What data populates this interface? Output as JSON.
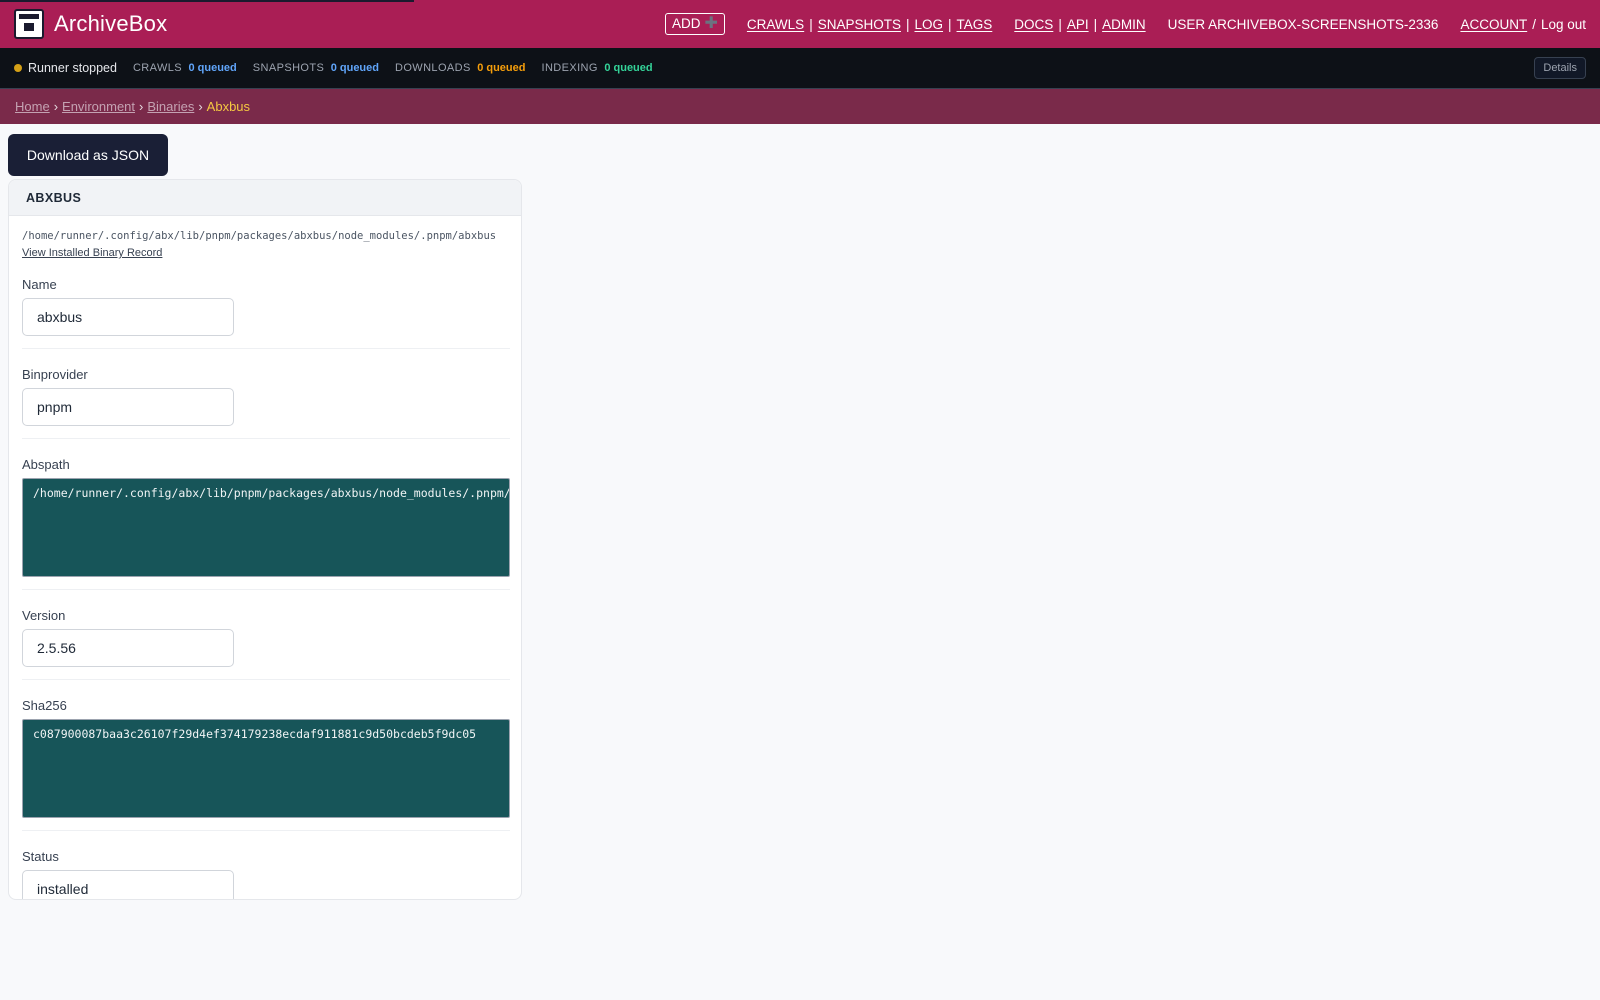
{
  "header": {
    "title": "ArchiveBox",
    "add_label": "ADD",
    "nav_main": [
      "CRAWLS",
      "SNAPSHOTS",
      "LOG",
      "TAGS"
    ],
    "nav_docs": [
      "DOCS",
      "API",
      "ADMIN"
    ],
    "user_label": "USER ARCHIVEBOX-SCREENSHOTS-2336",
    "account_label": "ACCOUNT",
    "account_sep": "/",
    "logout_label": "Log out"
  },
  "status": {
    "runner": "Runner stopped",
    "crawls_label": "CRAWLS",
    "crawls_value": "0 queued",
    "snapshots_label": "SNAPSHOTS",
    "snapshots_value": "0 queued",
    "downloads_label": "DOWNLOADS",
    "downloads_value": "0 queued",
    "indexing_label": "INDEXING",
    "indexing_value": "0 queued",
    "details_label": "Details",
    "colors": {
      "runner_dot": "#d4a017",
      "crawls": "#60a5fa",
      "downloads": "#f59e0b",
      "indexing": "#34d399"
    }
  },
  "breadcrumbs": {
    "home": "Home",
    "environment": "Environment",
    "binaries": "Binaries",
    "current": "Abxbus",
    "sep": "›"
  },
  "actions": {
    "download_json": "Download as JSON"
  },
  "card": {
    "title": "ABXBUS",
    "path": "/home/runner/.config/abx/lib/pnpm/packages/abxbus/node_modules/.pnpm/abxbus",
    "record_link": "View Installed Binary Record",
    "fields": {
      "name": {
        "label": "Name",
        "value": "abxbus"
      },
      "binprovider": {
        "label": "Binprovider",
        "value": "pnpm"
      },
      "abspath": {
        "label": "Abspath",
        "value": "/home/runner/.config/abx/lib/pnpm/packages/abxbus/node_modules/.pnpm/abxbus"
      },
      "version": {
        "label": "Version",
        "value": "2.5.56"
      },
      "sha256": {
        "label": "Sha256",
        "value": "c087900087baa3c26107f29d4ef374179238ecdaf911881c9d50bcdeb5f9dc05"
      },
      "status": {
        "label": "Status",
        "value": "installed"
      }
    }
  },
  "theme": {
    "brand": "#aa1e55",
    "breadcrumb_bg": "#7a2a4a",
    "code_bg": "#175559"
  }
}
